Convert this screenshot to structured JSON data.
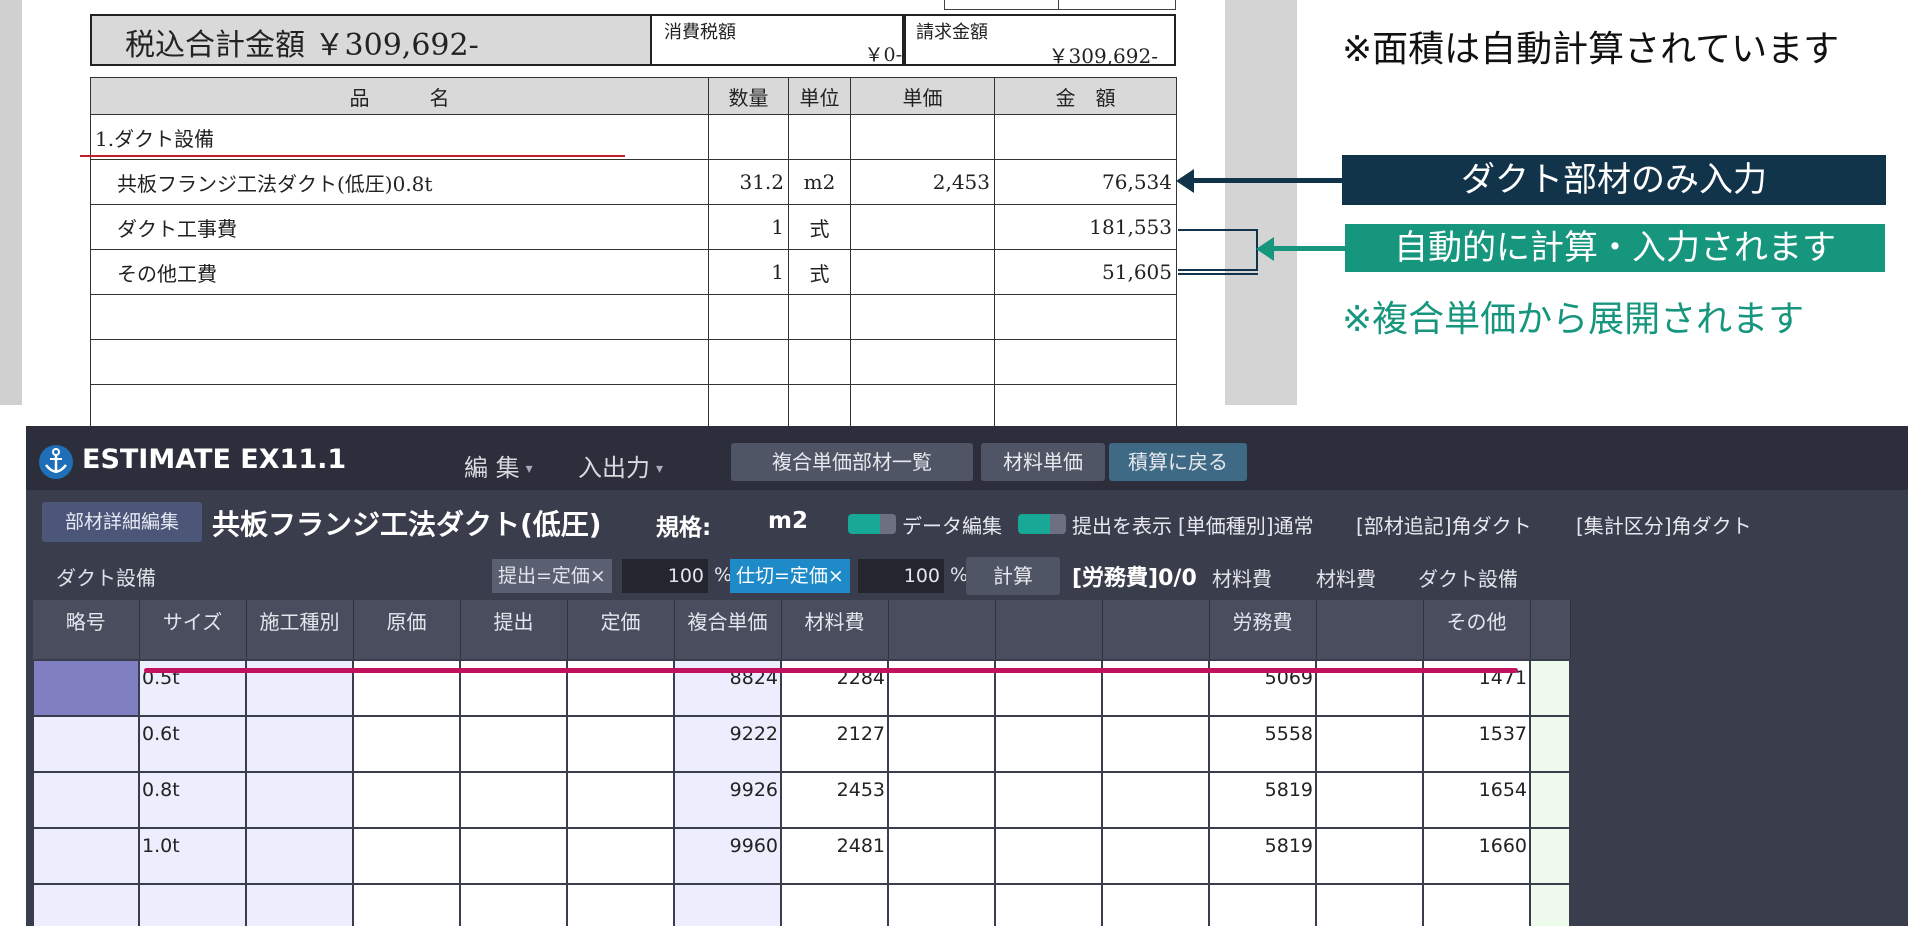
{
  "document": {
    "total_label": "税込合計金額 ￥309,692-",
    "tax_label": "消費税額",
    "tax_value": "￥0-",
    "bill_label": "請求金額",
    "bill_value": "￥309,692-",
    "table": {
      "headers": [
        "品　　　名",
        "数量",
        "単位",
        "単価",
        "金　額"
      ],
      "rows": [
        {
          "name": "1.ダクト設備",
          "qty": "",
          "unit": "",
          "price": "",
          "amount": ""
        },
        {
          "name": "共板フランジ工法ダクト(低圧)0.8t",
          "qty": "31.2",
          "unit": "m2",
          "price": "2,453",
          "amount": "76,534"
        },
        {
          "name": "ダクト工事費",
          "qty": "1",
          "unit": "式",
          "price": "",
          "amount": "181,553"
        },
        {
          "name": "その他工費",
          "qty": "1",
          "unit": "式",
          "price": "",
          "amount": "51,605"
        },
        {
          "name": "",
          "qty": "",
          "unit": "",
          "price": "",
          "amount": ""
        },
        {
          "name": "",
          "qty": "",
          "unit": "",
          "price": "",
          "amount": ""
        },
        {
          "name": "",
          "qty": "",
          "unit": "",
          "price": "",
          "amount": ""
        }
      ]
    }
  },
  "annotations": {
    "area_note": "※面積は自動計算されています",
    "duct_only": "ダクト部材のみ入力",
    "auto_calc": "自動的に計算・入力されます",
    "composite_note": "※複合単価から展開されます",
    "colors": {
      "navy": "#12344a",
      "teal": "#17967e",
      "red": "#c21e2b",
      "magenta": "#c0125e"
    }
  },
  "app": {
    "title": "ESTIMATE EX11.1",
    "logo_icon": "anchor-icon",
    "menu": [
      {
        "label": "編 集",
        "caret": "▾"
      },
      {
        "label": "入出力",
        "caret": "▾"
      }
    ],
    "toolbar": {
      "composite_list": "複合単価部材一覧",
      "material_price": "材料単価",
      "back": "積算に戻る"
    },
    "row2": {
      "detail_button": "部材詳細編集",
      "part_name": "共板フランジ工法ダクト(低圧)",
      "spec_label": "規格:",
      "spec_value": "m2",
      "toggle_data_edit": "データ編集",
      "toggle_show_submit": "提出を表示",
      "unit_type": "[単価種別]通常",
      "part_note": "[部材追記]角ダクト",
      "aggregate": "[集計区分]角ダクト"
    },
    "row3": {
      "category": "ダクト設備",
      "chip_submit": "提出=定価×",
      "submit_pct": "100",
      "pct_unit": "%",
      "chip_cut": "仕切=定価×",
      "cut_pct": "100",
      "calc_button": "計算",
      "labor_ratio": "[労務費]0/0",
      "label1": "材料費",
      "label2": "材料費",
      "label3": "ダクト設備"
    },
    "grid": {
      "headers": [
        "略号",
        "サイズ",
        "施工種別",
        "原価",
        "提出",
        "定価",
        "複合単価",
        "材料費",
        "",
        "",
        "",
        "労務費",
        "",
        "その他",
        ""
      ],
      "rows": [
        {
          "size": "0.5t",
          "composite": "8824",
          "material": "2284",
          "labor": "5069",
          "other": "1471"
        },
        {
          "size": "0.6t",
          "composite": "9222",
          "material": "2127",
          "labor": "5558",
          "other": "1537"
        },
        {
          "size": "0.8t",
          "composite": "9926",
          "material": "2453",
          "labor": "5819",
          "other": "1654"
        },
        {
          "size": "1.0t",
          "composite": "9960",
          "material": "2481",
          "labor": "5819",
          "other": "1660"
        },
        {
          "size": "",
          "composite": "",
          "material": "",
          "labor": "",
          "other": ""
        }
      ]
    }
  }
}
